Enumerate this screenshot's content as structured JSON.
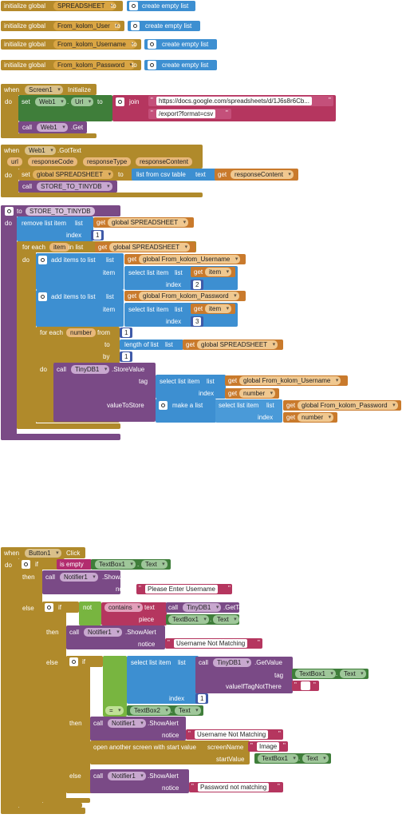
{
  "globals": [
    {
      "kw": "initialize global",
      "name": "SPREADSHEET",
      "to": "to",
      "action": "create empty list"
    },
    {
      "kw": "initialize global",
      "name": "From_kolom_User",
      "to": "to",
      "action": "create empty list"
    },
    {
      "kw": "initialize global",
      "name": "From_kolom_Username",
      "to": "to",
      "action": "create empty list"
    },
    {
      "kw": "initialize global",
      "name": "From_kolom_Password",
      "to": "to",
      "action": "create empty list"
    }
  ],
  "screen_init": {
    "when": "when",
    "component": "Screen1",
    "event": "Initialize",
    "do": "do",
    "set": "set",
    "set_comp": "Web1",
    "set_prop": "Url",
    "to": "to",
    "join": "join",
    "url1": "https://docs.google.com/spreadsheets/d/1J6s8r6Cb...",
    "url2": "/export?format=csv",
    "call": "call",
    "call_comp": "Web1",
    "call_method": ".Get"
  },
  "gettext": {
    "when": "when",
    "component": "Web1",
    "event": ".GotText",
    "params": [
      "url",
      "responseCode",
      "responseType",
      "responseContent"
    ],
    "do": "do",
    "set": "set",
    "var": "global SPREADSHEET",
    "to": "to",
    "csv": "list from csv table",
    "text_lbl": "text",
    "get": "get",
    "get_var": "responseContent",
    "call": "call",
    "proc": "STORE_TO_TINYDB"
  },
  "proc": {
    "to": "to",
    "name": "STORE_TO_TINYDB",
    "do": "do",
    "remove": "remove list item",
    "list_lbl": "list",
    "get": "get",
    "spreadsheet": "global SPREADSHEET",
    "index_lbl": "index",
    "index_val": "1",
    "foreach": "for each",
    "item_var": "item",
    "in_list": "in list",
    "add": "add items to list",
    "item_lbl": "item",
    "select": "select list item",
    "username_var": "global From_kolom_Username",
    "password_var": "global From_kolom_Password",
    "get_item": "item",
    "idx2": "2",
    "idx3": "3",
    "fornum": "for each",
    "num_var": "number",
    "from": "from",
    "from_val": "1",
    "to_lbl": "to",
    "length": "length of list",
    "by": "by",
    "by_val": "1",
    "call": "call",
    "tinydb": "TinyDB1",
    "store": ".StoreValue",
    "tag": "tag",
    "value_to_store": "valueToStore",
    "make_list": "make a list",
    "number": "number"
  },
  "click": {
    "when": "when",
    "component": "Button1",
    "event": "Click",
    "do": "do",
    "if": "if",
    "then": "then",
    "else": "else",
    "is_empty": "is empty",
    "textbox1": "TextBox1",
    "textbox2": "TextBox2",
    "text_prop": "Text",
    "call": "call",
    "notifier": "Notifier1",
    "show_alert": ".ShowAlert",
    "notice": "notice",
    "msg_enter": "Please Enter Username",
    "msg_user": "Username Not Matching",
    "msg_pass": "Password not matching",
    "not": "not",
    "contains": "contains",
    "text_lbl": "text",
    "piece": "piece",
    "tinydb": "TinyDB1",
    "get_tags": ".GetTags",
    "get_value": ".GetValue",
    "select": "select list item",
    "list_lbl": "list",
    "tag": "tag",
    "value_if": "valueIfTagNotThere",
    "index_lbl": "index",
    "index_val": "1",
    "eq": "=",
    "open_screen": "open another screen with start value",
    "screen_name": "screenName",
    "image": "Image",
    "start_value": "startValue"
  },
  "colors": {
    "variables": "#b58a2b",
    "control": "#b08a2b",
    "procedures": "#7a4a86",
    "lists": "#3d8fd1",
    "text": "#b5365f",
    "logic": "#78b540",
    "math": "#3f5aa8"
  }
}
